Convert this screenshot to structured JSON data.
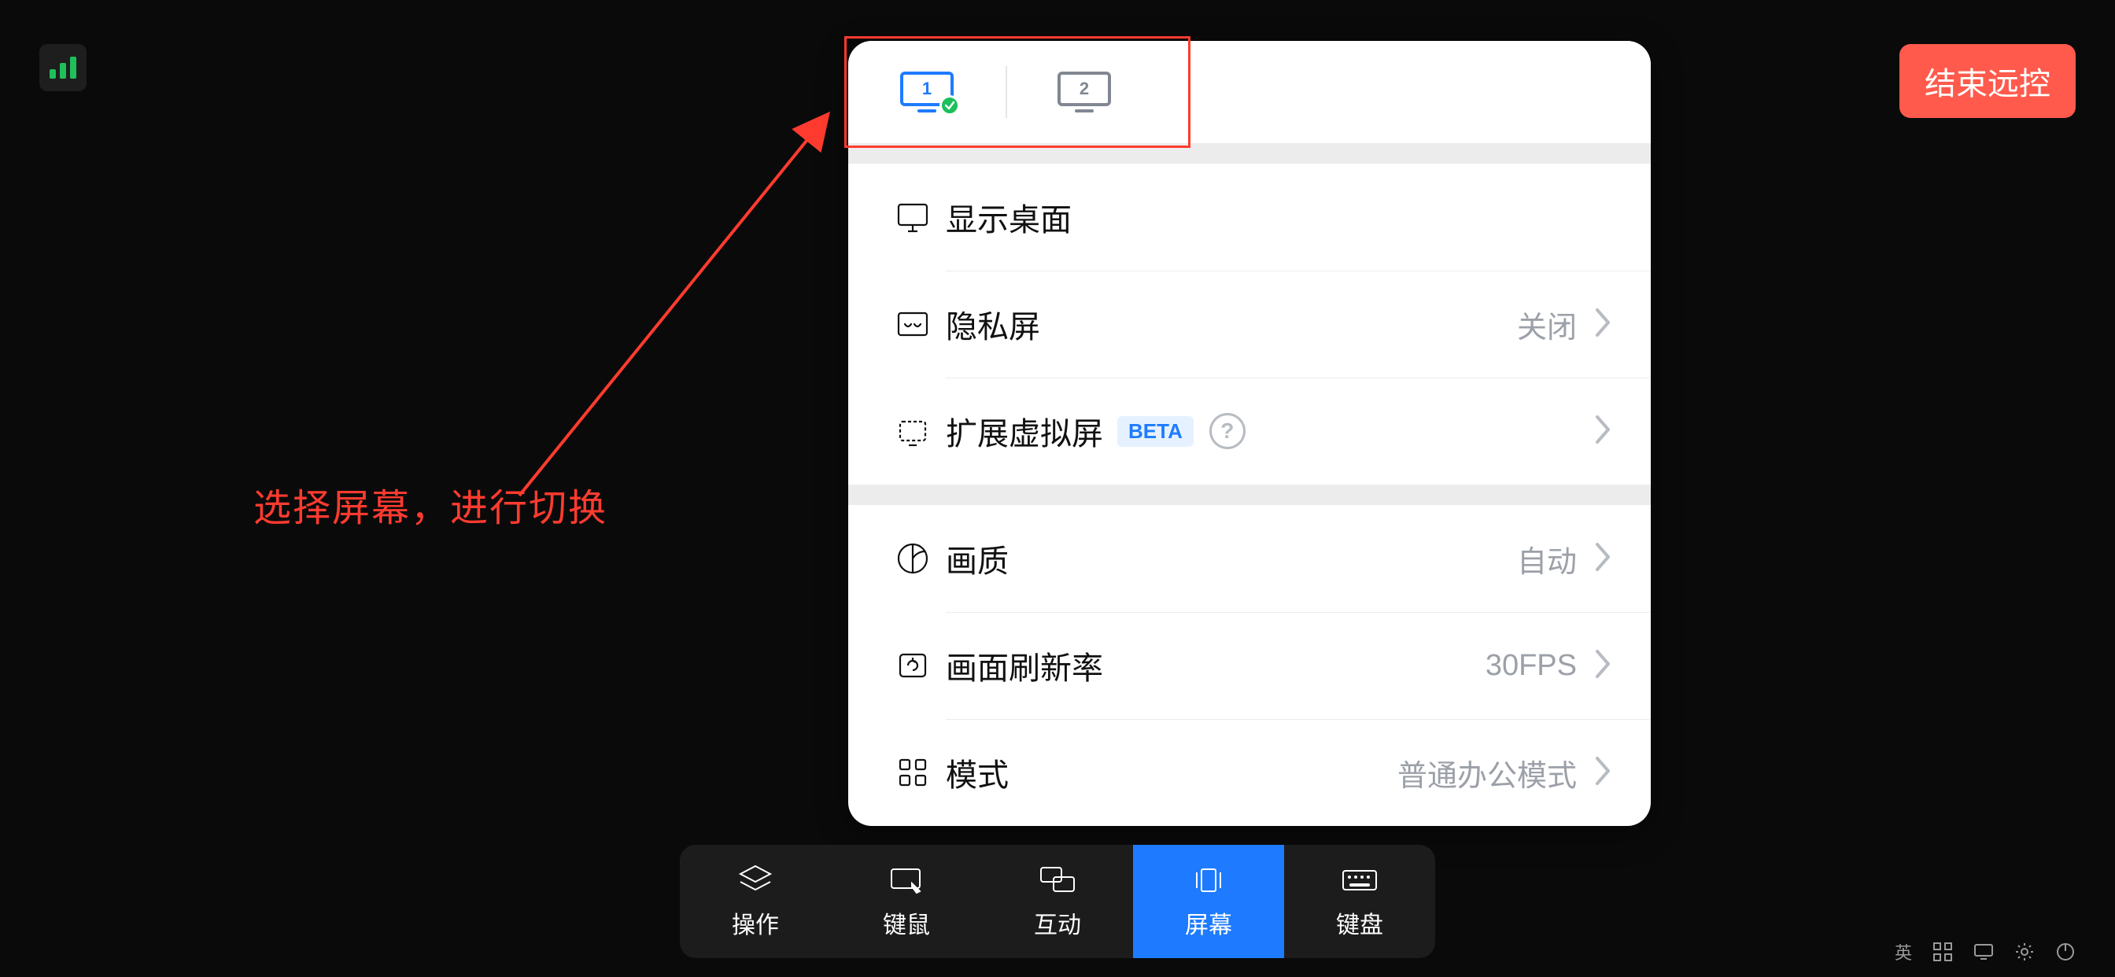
{
  "header": {
    "end_button": "结束远控"
  },
  "annotation": {
    "text": "选择屏幕，进行切换"
  },
  "panel": {
    "screens": [
      {
        "num": "1",
        "active": true
      },
      {
        "num": "2",
        "active": false
      }
    ],
    "rows": {
      "show_desktop": "显示桌面",
      "privacy_screen": {
        "label": "隐私屏",
        "value": "关闭"
      },
      "virtual_screen": {
        "label": "扩展虚拟屏",
        "badge": "BETA"
      },
      "quality": {
        "label": "画质",
        "value": "自动"
      },
      "fps": {
        "label": "画面刷新率",
        "value": "30FPS"
      },
      "mode": {
        "label": "模式",
        "value": "普通办公模式"
      }
    }
  },
  "toolbar": {
    "items": [
      {
        "key": "ops",
        "label": "操作"
      },
      {
        "key": "km",
        "label": "键鼠"
      },
      {
        "key": "interact",
        "label": "互动"
      },
      {
        "key": "screen",
        "label": "屏幕"
      },
      {
        "key": "keyboard",
        "label": "键盘"
      }
    ],
    "active": "screen"
  },
  "status_tray": {
    "ime": "英"
  }
}
